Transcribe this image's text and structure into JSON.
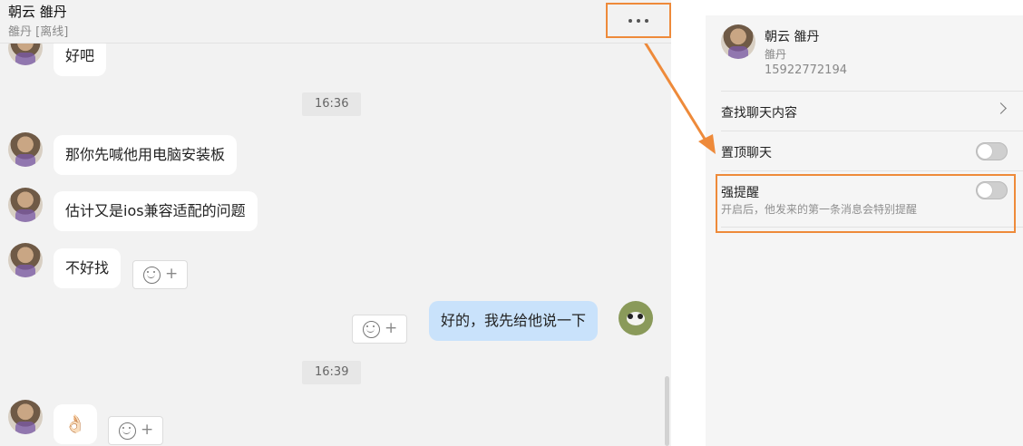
{
  "header": {
    "title": "朝云 雒丹",
    "status": "雒丹 [离线]",
    "more_icon": "more-dots-icon"
  },
  "messages": {
    "m1": "好吧",
    "time1": "16:36",
    "m2": "那你先喊他用电脑安装板",
    "m3": "估计又是ios兼容适配的问题",
    "m4": "不好找",
    "m5": "好的，我先给他说一下",
    "time2": "16:39",
    "m6": "👌🏻"
  },
  "reaction": {
    "icon": "smiley-icon",
    "plus": "+"
  },
  "detail": {
    "contact_name": "朝云 雒丹",
    "contact_nick": "雒丹",
    "contact_phone": "15922772194",
    "search_label": "查找聊天内容",
    "pin_label": "置顶聊天",
    "pin_on": false,
    "alert_label": "强提醒",
    "alert_desc": "开启后，他发来的第一条消息会特别提醒",
    "alert_on": false
  },
  "colors": {
    "annotation": "#ee8a3a",
    "self_bubble": "#c9e2fb",
    "chat_bg": "#f2f2f2"
  }
}
